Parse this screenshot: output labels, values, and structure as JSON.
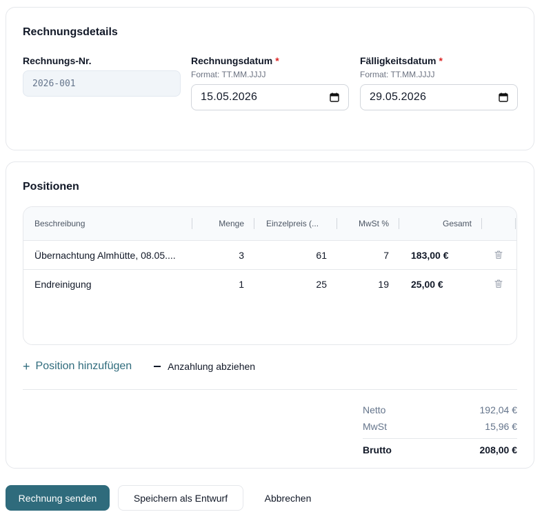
{
  "details": {
    "title": "Rechnungsdetails",
    "invoice_no": {
      "label": "Rechnungs-Nr.",
      "value": "2026-001"
    },
    "invoice_date": {
      "label": "Rechnungsdatum",
      "required": "*",
      "hint": "Format: TT.MM.JJJJ",
      "value": "15.05.2026"
    },
    "due_date": {
      "label": "Fälligkeitsdatum",
      "required": "*",
      "hint": "Format: TT.MM.JJJJ",
      "value": "29.05.2026"
    }
  },
  "positions": {
    "title": "Positionen",
    "columns": [
      "Beschreibung",
      "Menge",
      "Einzelpreis (...",
      "MwSt %",
      "Gesamt"
    ],
    "rows": [
      {
        "description": "Übernachtung Almhütte, 08.05....",
        "qty": "3",
        "unit_price": "61",
        "vat": "7",
        "total": "183,00 €"
      },
      {
        "description": "Endreinigung",
        "qty": "1",
        "unit_price": "25",
        "vat": "19",
        "total": "25,00 €"
      }
    ],
    "add_label": "Position hinzufügen",
    "deduct_label": "Anzahlung abziehen"
  },
  "totals": {
    "net_label": "Netto",
    "net_value": "192,04 €",
    "vat_label": "MwSt",
    "vat_value": "15,96 €",
    "gross_label": "Brutto",
    "gross_value": "208,00 €"
  },
  "buttons": {
    "send": "Rechnung senden",
    "save_draft": "Speichern als Entwurf",
    "cancel": "Abbrechen"
  },
  "colors": {
    "accent": "#2f6b7c",
    "required": "#dc2626"
  }
}
